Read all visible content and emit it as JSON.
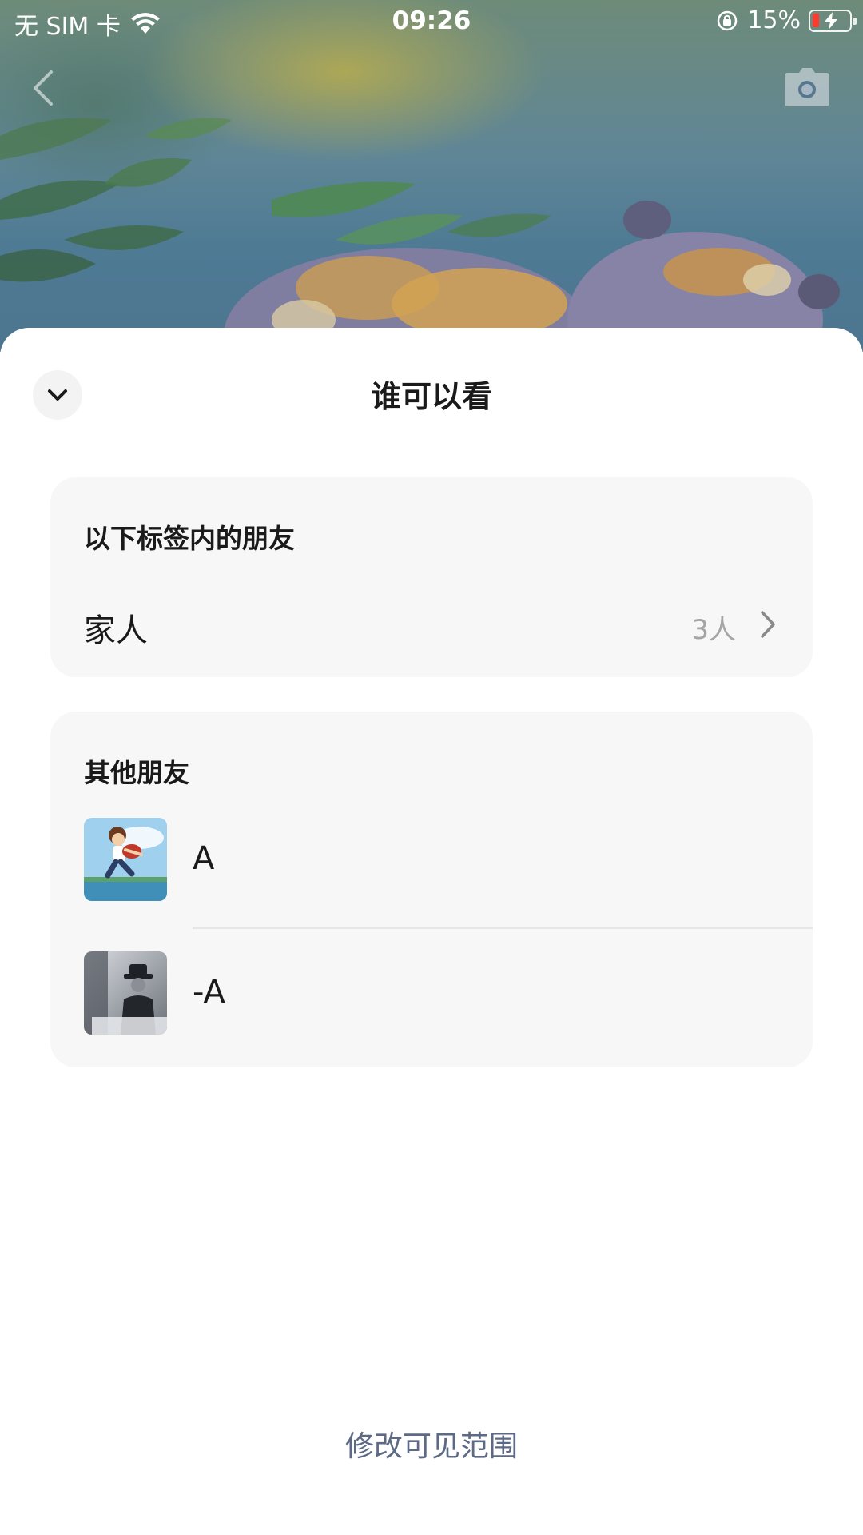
{
  "status_bar": {
    "carrier": "无 SIM 卡",
    "time": "09:26",
    "battery_percent": "15%",
    "battery_color": "#ff3b30"
  },
  "nav": {
    "back_icon": "chevron-left-icon",
    "camera_icon": "camera-icon"
  },
  "sheet": {
    "title": "谁可以看",
    "collapse_icon": "chevron-down-icon",
    "tag_section": {
      "header": "以下标签内的朋友",
      "tags": [
        {
          "name": "家人",
          "count": "3人"
        }
      ]
    },
    "others_section": {
      "header": "其他朋友",
      "friends": [
        {
          "name": "A"
        },
        {
          "name": "-A"
        }
      ]
    },
    "modify_label": "修改可见范围"
  },
  "colors": {
    "card_background": "#f7f7f7",
    "link": "#5d6a86",
    "secondary_text": "#a5a5a5"
  }
}
